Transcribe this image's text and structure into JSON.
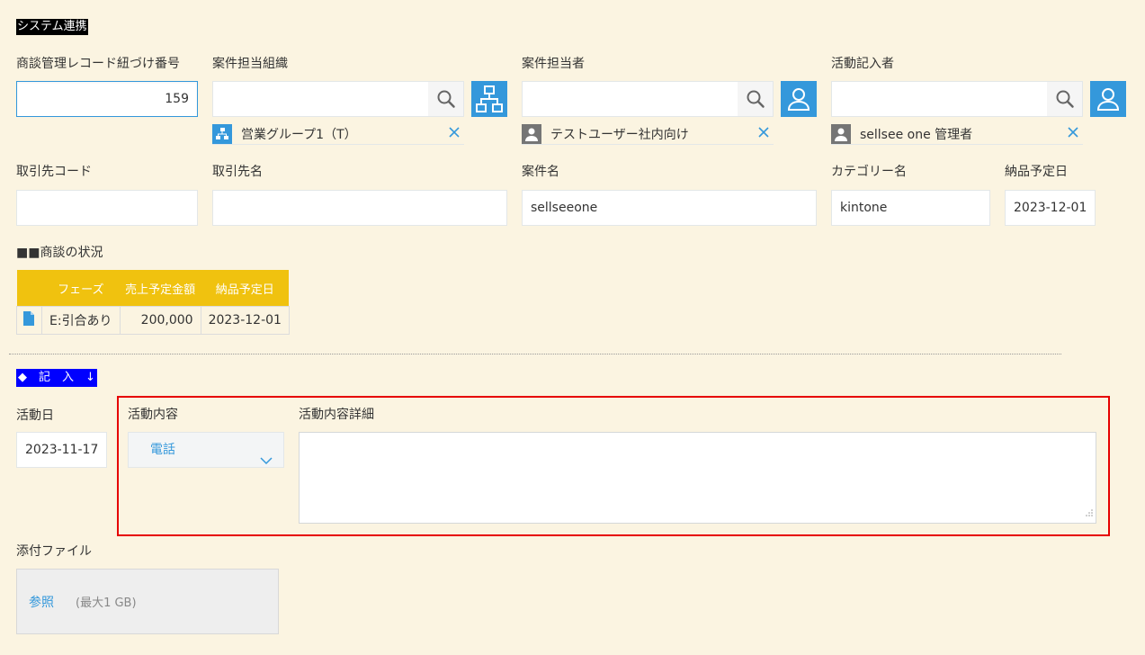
{
  "section_system": "システム連携",
  "fields": {
    "deal_number": {
      "label": "商談管理レコード紐づけ番号",
      "value": "159"
    },
    "org": {
      "label": "案件担当組織",
      "chip": "営業グループ1（T）"
    },
    "person": {
      "label": "案件担当者",
      "chip": "テストユーザー社内向け"
    },
    "recorder": {
      "label": "活動記入者",
      "chip": "sellsee one 管理者"
    },
    "client_code": {
      "label": "取引先コード",
      "value": ""
    },
    "client_name": {
      "label": "取引先名",
      "value": ""
    },
    "case_name": {
      "label": "案件名",
      "value": "sellseeone"
    },
    "category": {
      "label": "カテゴリー名",
      "value": "kintone"
    },
    "delivery_date": {
      "label": "納品予定日",
      "value": "2023-12-01"
    }
  },
  "deal_status": {
    "title": "■■商談の状況",
    "headers": [
      "フェーズ",
      "売上予定金額",
      "納品予定日"
    ],
    "rows": [
      {
        "phase": "E:引合あり",
        "amount": "200,000",
        "date": "2023-12-01"
      }
    ]
  },
  "section_entry": "◆　記　入　↓",
  "activity": {
    "date_label": "活動日",
    "date_value": "2023-11-17",
    "content_label": "活動内容",
    "content_value": "電話",
    "detail_label": "活動内容詳細",
    "detail_value": ""
  },
  "attachment": {
    "label": "添付ファイル",
    "browse": "参照",
    "limit": "(最大1 GB)"
  },
  "icons": [
    "search-icon",
    "org-icon",
    "user-icon",
    "close-icon",
    "file-icon",
    "chevron-down-icon",
    "resize-icon"
  ],
  "colors": {
    "accent": "#3498db",
    "highlight": "#e60000",
    "table_header": "#f0c20f",
    "section_blue": "#0000ff"
  }
}
